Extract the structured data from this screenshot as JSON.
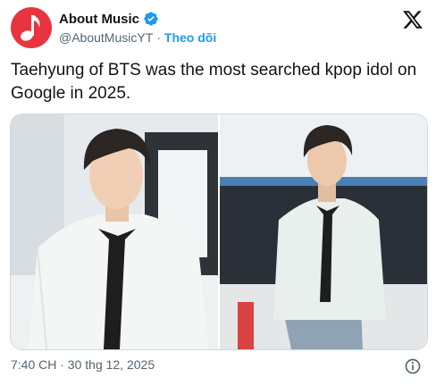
{
  "account": {
    "display_name": "About Music",
    "handle": "@AboutMusicYT",
    "separator": "·",
    "follow_label": "Theo dõi",
    "avatar_icon": "music-note-icon",
    "verified_icon": "verified-badge-icon"
  },
  "brand": {
    "logo_icon": "x-logo-icon"
  },
  "tweet": {
    "text": "Taehyung of BTS was the most searched kpop idol on Google in 2025."
  },
  "media": {
    "photos": [
      {
        "icon": "photo-1"
      },
      {
        "icon": "photo-2"
      }
    ]
  },
  "footer": {
    "timestamp": "7:40 CH · 30 thg 12, 2025",
    "info_icon": "info-icon"
  },
  "colors": {
    "avatar_bg": "#e8343f",
    "verified": "#1d9bf0",
    "link": "#1d9bf0",
    "secondary_text": "#536471",
    "primary_text": "#0f1419",
    "border": "#cfd9de"
  }
}
